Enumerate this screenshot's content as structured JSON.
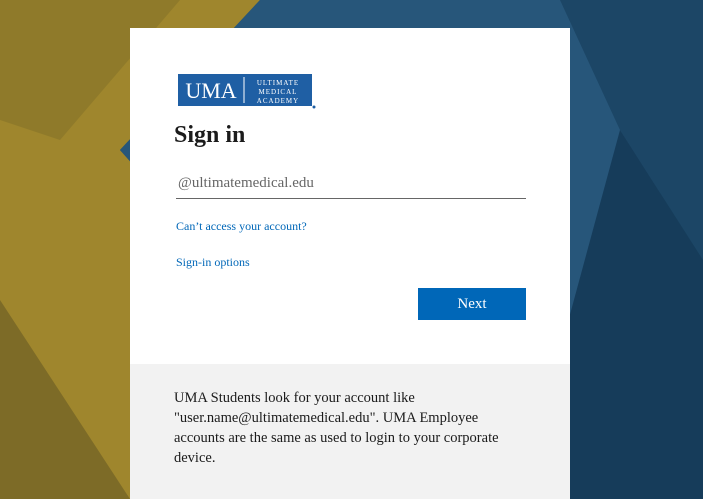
{
  "brand": {
    "logo_main": "UMA",
    "logo_line1": "ULTIMATE",
    "logo_line2": "MEDICAL",
    "logo_line3": "ACADEMY",
    "color": "#1f5fa4"
  },
  "signin": {
    "title": "Sign in",
    "email_placeholder": "@ultimatemedical.edu",
    "cant_access": "Can’t access your account?",
    "options": "Sign-in options",
    "next": "Next"
  },
  "info": {
    "text": "UMA Students look for your account like \"user.name@ultimatemedical.edu\". UMA Employee accounts are the same as used to login to your corporate device."
  },
  "colors": {
    "accent": "#0067b8",
    "gold": "#a0862f",
    "navy": "#1d4f6e"
  }
}
